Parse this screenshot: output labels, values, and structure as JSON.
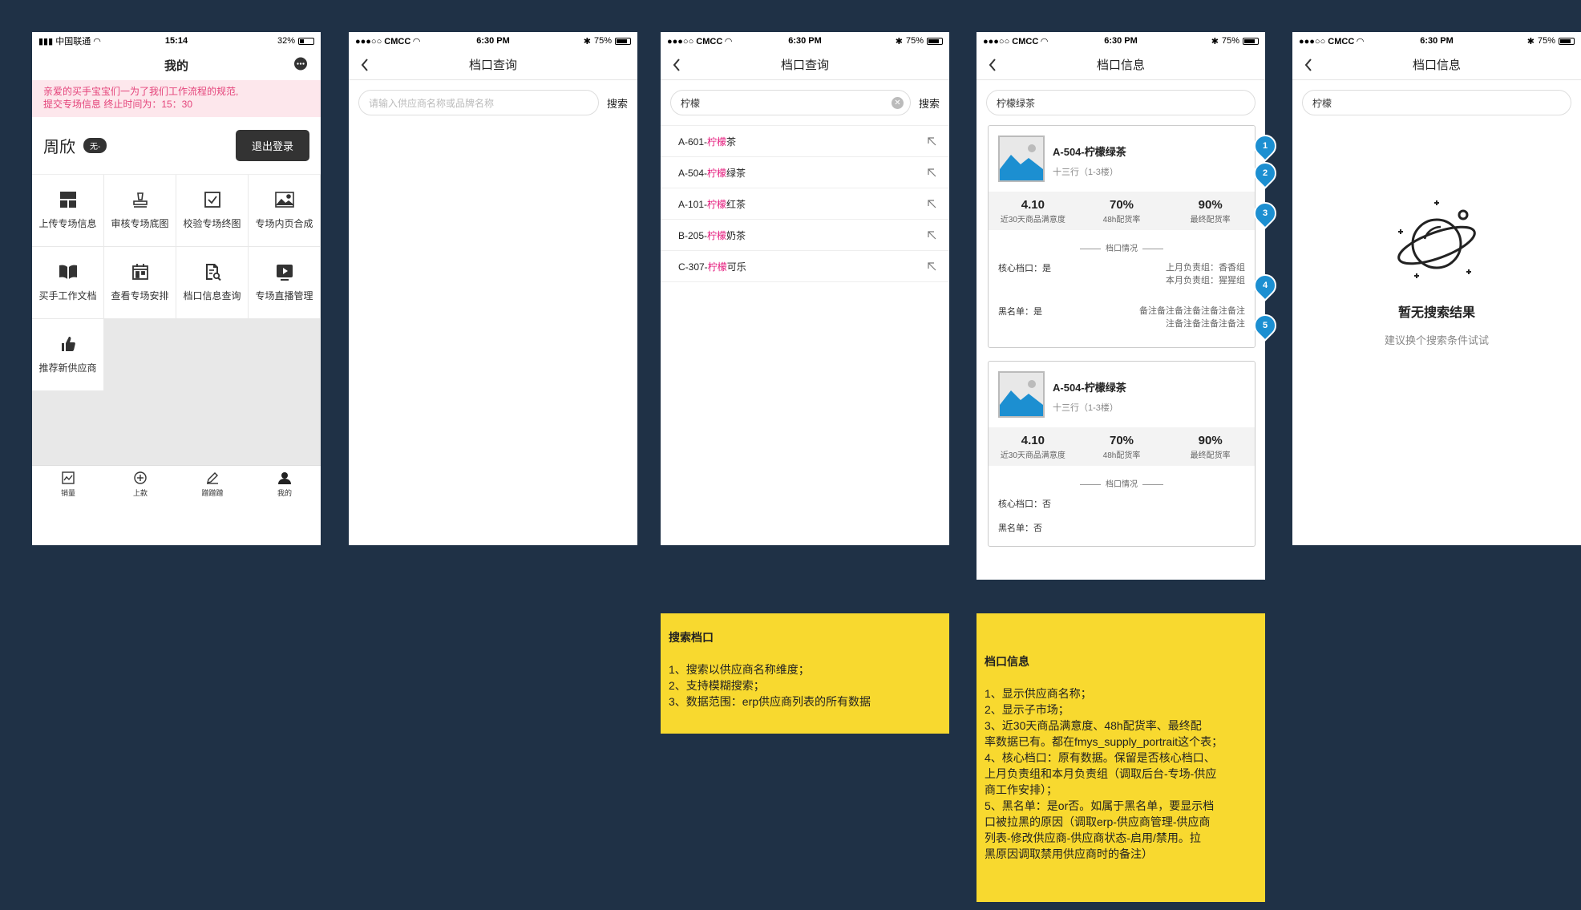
{
  "p1": {
    "status": {
      "carrier": "中国联通",
      "time": "15:14",
      "battery": "32%"
    },
    "title": "我的",
    "notice_line1": "亲爱的买手宝宝们一为了我们工作流程的规范,",
    "notice_line2": "提交专场信息 终止时间为：15：30",
    "user_name": "周欣",
    "badge": "无-",
    "logout": "退出登录",
    "menu": [
      {
        "label": "上传专场信息",
        "icon": "layout-icon"
      },
      {
        "label": "审核专场底图",
        "icon": "stamp-icon"
      },
      {
        "label": "校验专场终图",
        "icon": "check-image-icon"
      },
      {
        "label": "专场内页合成",
        "icon": "image-icon"
      },
      {
        "label": "买手工作文档",
        "icon": "book-icon"
      },
      {
        "label": "查看专场安排",
        "icon": "calendar-icon"
      },
      {
        "label": "档口信息查询",
        "icon": "doc-search-icon"
      },
      {
        "label": "专场直播管理",
        "icon": "play-icon"
      },
      {
        "label": "推荐新供应商",
        "icon": "thumbs-up-icon"
      }
    ],
    "tabs": [
      {
        "label": "销量",
        "icon": "chart-icon"
      },
      {
        "label": "上款",
        "icon": "plus-circle-icon"
      },
      {
        "label": "蹭蹭蹭",
        "icon": "pencil-icon"
      },
      {
        "label": "我的",
        "icon": "user-icon"
      }
    ]
  },
  "status_ios": {
    "carrier": "CMCC",
    "time": "6:30 PM",
    "battery": "75%"
  },
  "p2": {
    "title": "档口查询",
    "placeholder": "请输入供应商名称或品牌名称",
    "search_btn": "搜索"
  },
  "p3": {
    "title": "档口查询",
    "query": "柠檬",
    "search_btn": "搜索",
    "suggestions": [
      {
        "prefix": "A-601-",
        "hl": "柠檬",
        "suffix": "茶"
      },
      {
        "prefix": "A-504-",
        "hl": "柠檬",
        "suffix": "绿茶"
      },
      {
        "prefix": "A-101-",
        "hl": "柠檬",
        "suffix": "红茶"
      },
      {
        "prefix": "B-205-",
        "hl": "柠檬",
        "suffix": "奶茶"
      },
      {
        "prefix": "C-307-",
        "hl": "柠檬",
        "suffix": "可乐"
      }
    ]
  },
  "p4": {
    "title": "档口信息",
    "query": "柠檬绿茶",
    "cards": [
      {
        "name": "A-504-柠檬绿茶",
        "market": "十三行（1-3楼）",
        "stats": [
          {
            "value": "4.10",
            "label": "近30天商品满意度"
          },
          {
            "value": "70%",
            "label": "48h配货率"
          },
          {
            "value": "90%",
            "label": "最终配货率"
          }
        ],
        "section": "档口情况",
        "core": "核心档口：是",
        "last_group": "上月负责组：香香组",
        "this_group": "本月负责组：猩猩组",
        "blacklist": "黑名单：是",
        "remark1": "备注备注备注备注备注备注",
        "remark2": "注备注备注备注备注"
      },
      {
        "name": "A-504-柠檬绿茶",
        "market": "十三行（1-3楼）",
        "stats": [
          {
            "value": "4.10",
            "label": "近30天商品满意度"
          },
          {
            "value": "70%",
            "label": "48h配货率"
          },
          {
            "value": "90%",
            "label": "最终配货率"
          }
        ],
        "section": "档口情况",
        "core": "核心档口：否",
        "blacklist": "黑名单：否"
      }
    ],
    "pins": [
      "1",
      "2",
      "3",
      "4",
      "5"
    ]
  },
  "p5": {
    "title": "档口信息",
    "query": "柠檬",
    "empty_title": "暂无搜索结果",
    "empty_sub": "建议换个搜索条件试试"
  },
  "note1": {
    "title": "搜索档口",
    "lines": [
      "1、搜索以供应商名称维度；",
      "2、支持模糊搜索；",
      "3、数据范围：erp供应商列表的所有数据"
    ]
  },
  "note2": {
    "title": "档口信息",
    "lines": [
      "1、显示供应商名称；",
      "2、显示子市场；",
      "3、近30天商品满意度、48h配货率、最终配",
      "率数据已有。都在fmys_supply_portrait这个表；",
      "4、核心档口：原有数据。保留是否核心档口、",
      "上月负责组和本月负责组（调取后台-专场-供应",
      "商工作安排）；",
      "5、黑名单：是or否。如属于黑名单，要显示档",
      "口被拉黑的原因（调取erp-供应商管理-供应商",
      "列表-修改供应商-供应商状态-启用/禁用。拉",
      "黑原因调取禁用供应商时的备注）"
    ]
  }
}
